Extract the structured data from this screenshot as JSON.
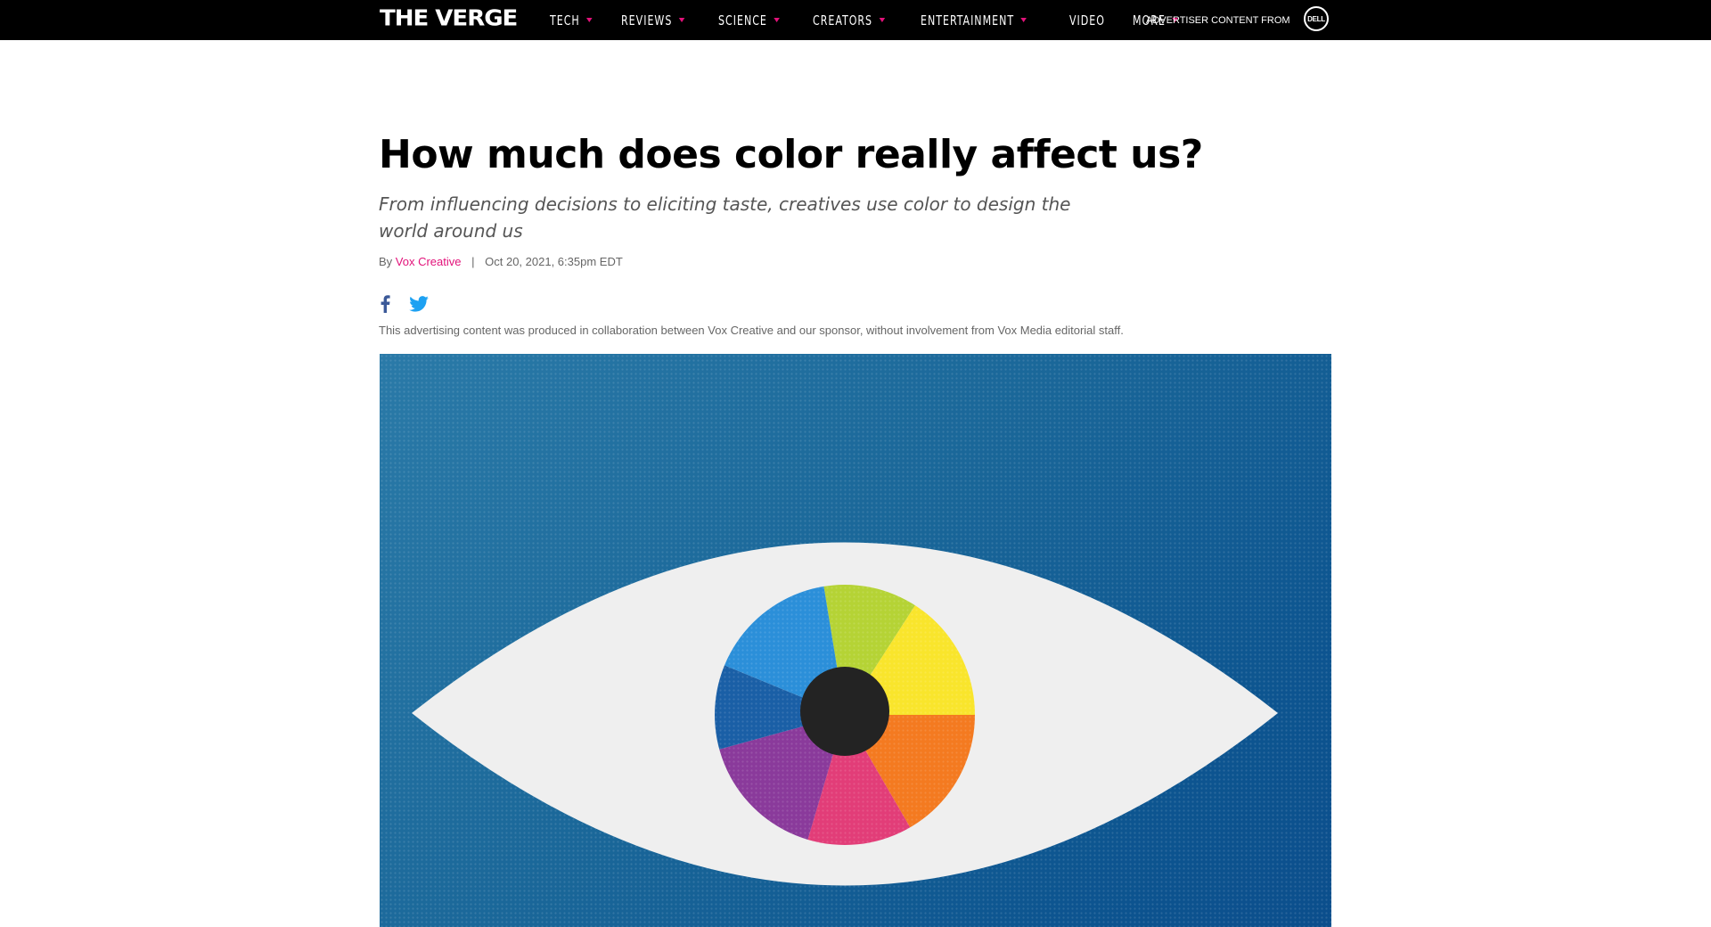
{
  "header": {
    "logo": "THE VERGE",
    "nav": [
      {
        "label": "TECH",
        "has_menu": true
      },
      {
        "label": "REVIEWS",
        "has_menu": true
      },
      {
        "label": "SCIENCE",
        "has_menu": true
      },
      {
        "label": "CREATORS",
        "has_menu": true
      },
      {
        "label": "ENTERTAINMENT",
        "has_menu": true
      },
      {
        "label": "VIDEO",
        "has_menu": false
      },
      {
        "label": "MORE",
        "has_menu": true
      }
    ],
    "advertiser_label": "ADVERTISER CONTENT FROM",
    "sponsor_logo": "DELL"
  },
  "article": {
    "title": "How much does color really affect us?",
    "subtitle": "From influencing decisions to eliciting taste, creatives use color to design the world around us",
    "by": "By",
    "author": "Vox Creative",
    "separator": "|",
    "date": "Oct 20, 2021, 6:35pm EDT",
    "disclaimer": "This advertising content was produced in collaboration between Vox Creative and our sponsor, without involvement from Vox Media editorial staff."
  },
  "share": {
    "facebook_icon": "facebook-icon",
    "twitter_icon": "twitter-icon"
  },
  "hero": {
    "icon": "color-wheel-eye-illustration",
    "background_color": "#1a6799",
    "iris_colors": [
      "#f9e52c",
      "#f47a20",
      "#e23d78",
      "#8a3a9b",
      "#1a5fa6",
      "#2b8fd9",
      "#b5d335"
    ]
  },
  "colors": {
    "accent": "#e2127a",
    "nav_bg": "#000000",
    "twitter": "#1da1f2",
    "facebook": "#3b5998"
  }
}
